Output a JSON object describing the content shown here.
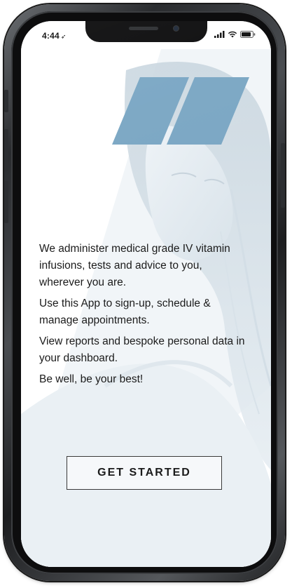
{
  "status_bar": {
    "time": "4:44",
    "location_glyph": "➶",
    "icons": [
      "signal-icon",
      "wifi-icon",
      "battery-icon"
    ]
  },
  "logo": {
    "icon": "parallelogram-logo-icon",
    "color": "#7ba7c4"
  },
  "intro": {
    "paragraph_1": "We administer medical grade IV vitamin infusions, tests and advice to you, wherever you are.",
    "paragraph_2": "Use this App to sign-up, schedule & manage appointments.",
    "paragraph_3": "View reports and bespoke personal data in your dashboard.",
    "paragraph_4": "Be well, be your best!"
  },
  "actions": {
    "get_started_label": "GET STARTED"
  },
  "colors": {
    "accent": "#7ba7c4",
    "text": "#1b1b1b",
    "frame": "#2a2c2f"
  }
}
